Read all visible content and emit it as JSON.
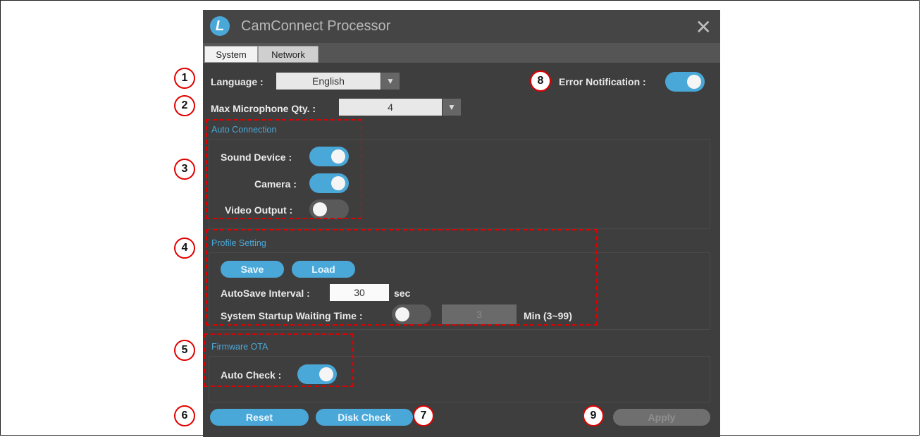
{
  "window": {
    "title": "CamConnect Processor",
    "logo_letter": "L",
    "close_glyph": "✕"
  },
  "tabs": [
    {
      "label": "System"
    },
    {
      "label": "Network"
    }
  ],
  "system": {
    "language_label": "Language :",
    "language_value": "English",
    "max_mic_label": "Max Microphone Qty. :",
    "max_mic_value": "4",
    "error_notification_label": "Error Notification :",
    "error_notification_on": true
  },
  "auto_connection": {
    "title": "Auto Connection",
    "sound_device_label": "Sound Device :",
    "sound_device_on": true,
    "camera_label": "Camera :",
    "camera_on": true,
    "video_output_label": "Video Output :",
    "video_output_on": false
  },
  "profile_setting": {
    "title": "Profile Setting",
    "save_label": "Save",
    "load_label": "Load",
    "autosave_label": "AutoSave Interval :",
    "autosave_value": "30",
    "autosave_unit": "sec",
    "startup_label": "System Startup Waiting Time :",
    "startup_on": false,
    "startup_value": "3",
    "startup_unit": "Min (3~99)"
  },
  "firmware_ota": {
    "title": "Firmware OTA",
    "auto_check_label": "Auto Check :",
    "auto_check_on": true
  },
  "footer": {
    "reset_label": "Reset",
    "disk_check_label": "Disk Check",
    "apply_label": "Apply"
  },
  "callouts": [
    "1",
    "2",
    "3",
    "4",
    "5",
    "6",
    "7",
    "8",
    "9"
  ],
  "icons": {
    "dropdown": "chevron-down-icon",
    "close": "close-icon",
    "logo": "app-logo-icon"
  },
  "colors": {
    "accent": "#4aa8d8",
    "window_bg": "#3e3e3e",
    "annotation": "#e00000"
  }
}
